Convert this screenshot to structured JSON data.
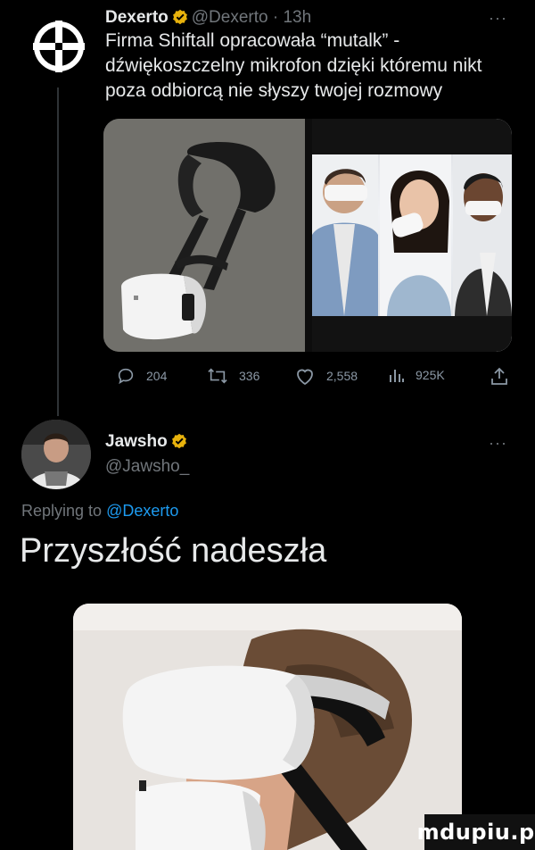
{
  "tweet1": {
    "author_name": "Dexerto",
    "handle_time": "@Dexerto · 13h",
    "text": "Firma Shiftall opracowała “mutalk” -\ndźwiękoszczelny mikrofon dzięki któremu nikt\npoza odbiorcą nie słyszy twojej rozmowy",
    "stats": {
      "replies": "204",
      "retweets": "336",
      "likes": "2,558",
      "views": "925K"
    },
    "more_icon": "more-dots-icon"
  },
  "tweet2": {
    "author_name": "Jawsho",
    "handle": "@Jawsho_",
    "reply_prefix": "Replying to ",
    "reply_target": "@Dexerto",
    "text": "Przyszłość nadeszła",
    "more_icon": "more-dots-icon"
  },
  "watermark": "mdupiu.pl",
  "colors": {
    "background": "#000000",
    "muted_text": "#71767b",
    "link": "#1d9bf0",
    "verified_badge": "#e8b20c"
  }
}
